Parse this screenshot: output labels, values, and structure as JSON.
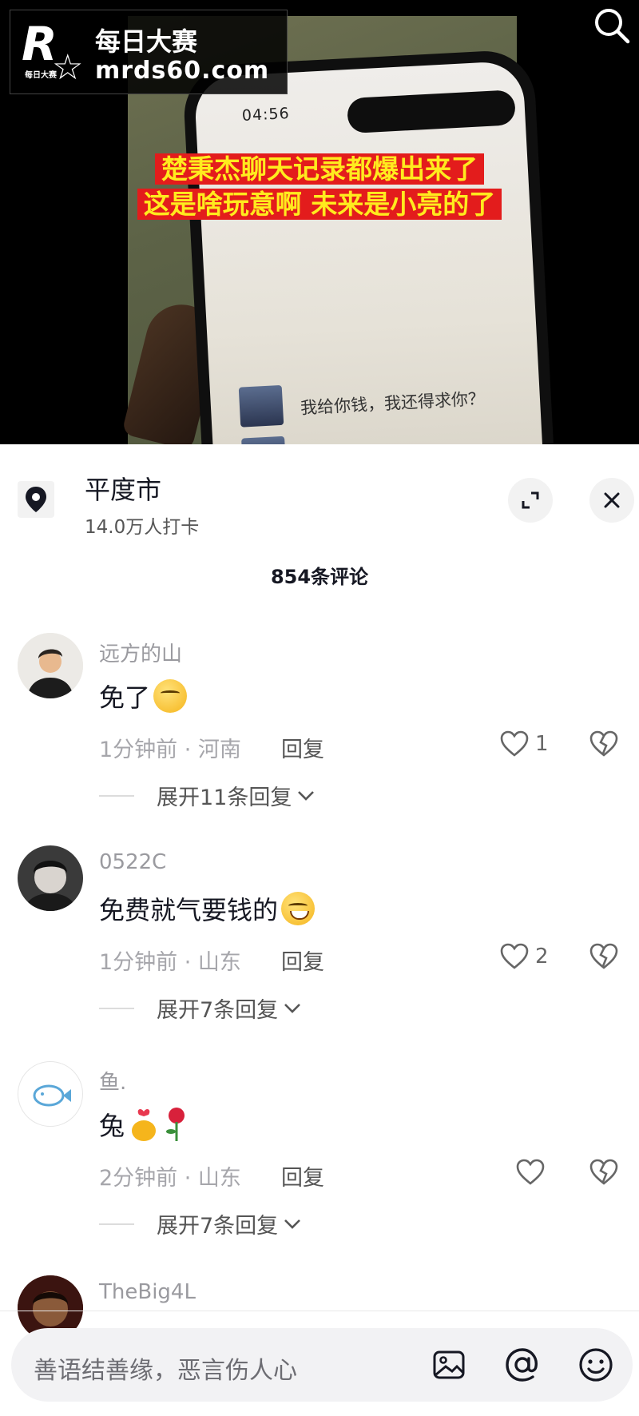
{
  "video": {
    "caption_line1": "楚秉杰聊天记录都爆出来了",
    "caption_line2": "这是啥玩意啊 未来是小亮的了",
    "phone_time": "04:56",
    "chat_text": "我给你钱，我还得求你？"
  },
  "watermark": {
    "logo_letter": "R",
    "logo_small": "每日大赛",
    "line1": "每日大赛",
    "line2": "mrds60.com"
  },
  "location": {
    "title": "平度市",
    "subtitle": "14.0万人打卡"
  },
  "comments_count": "854条评论",
  "comments": [
    {
      "user": "远方的山",
      "text": "免了",
      "meta": "1分钟前 · 河南",
      "reply": "回复",
      "likes": "1",
      "expand": "展开11条回复"
    },
    {
      "user": "0522C",
      "text": "免费就气要钱的",
      "meta": "1分钟前 · 山东",
      "reply": "回复",
      "likes": "2",
      "expand": "展开7条回复"
    },
    {
      "user": "鱼.",
      "text": "兔",
      "meta": "2分钟前 · 山东",
      "reply": "回复",
      "likes": "",
      "expand": "展开7条回复"
    },
    {
      "user": "TheBig4L"
    }
  ],
  "input": {
    "placeholder": "善语结善缘，恶言伤人心"
  },
  "colors": {
    "caption_text": "#ffeb1e",
    "caption_bg": "#e31c1c",
    "text_primary": "#161823",
    "text_secondary": "#a6a6ab"
  }
}
